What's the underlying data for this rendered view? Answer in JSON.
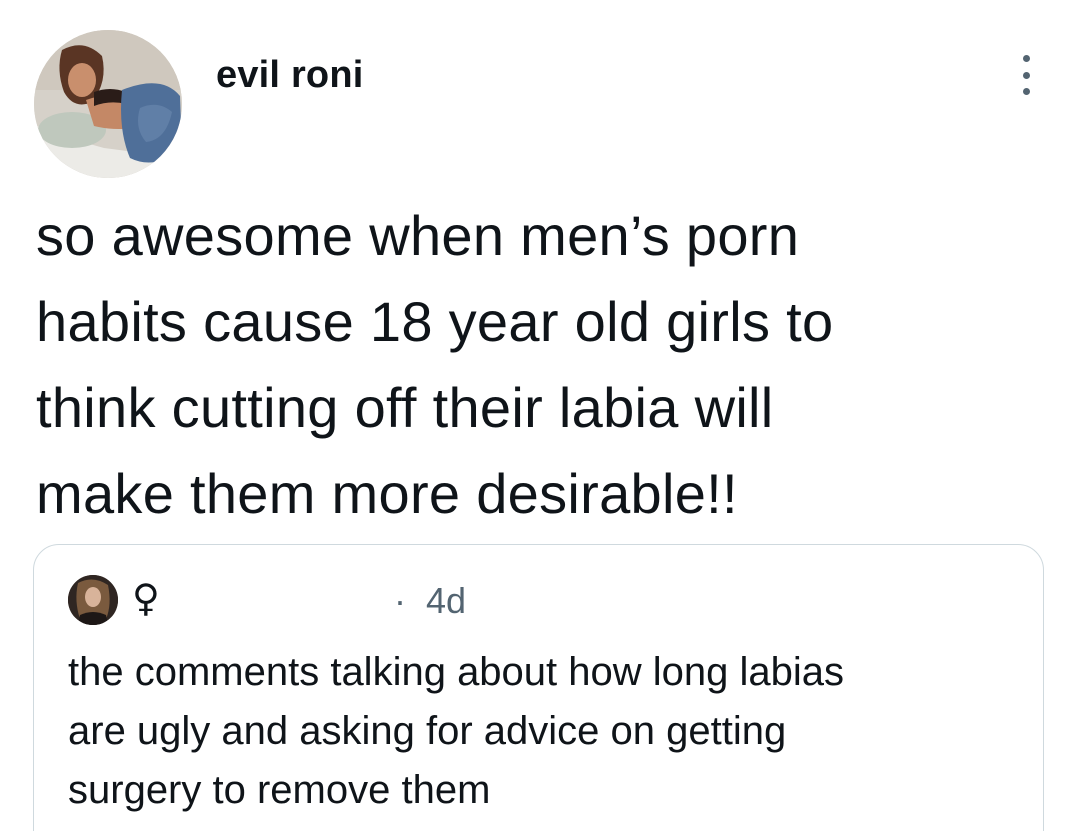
{
  "author": {
    "display_name": "evil roni",
    "avatar_icon": "profile-photo",
    "more_icon": "more-vertical-icon"
  },
  "tweet": {
    "lines": [
      "so awesome when men’s porn",
      "habits cause 18 year old girls to",
      "think cutting off their labia will",
      "make them more desirable!!"
    ]
  },
  "quoted_tweet": {
    "author_name": "♀",
    "separator": "·",
    "time": "4d",
    "lines": [
      "the comments talking about how long labias",
      "are ugly and asking for advice on getting",
      "surgery to remove them"
    ]
  },
  "colors": {
    "text_primary": "#0f1419",
    "text_secondary": "#536471",
    "border": "#cfd9de",
    "background": "#ffffff"
  }
}
